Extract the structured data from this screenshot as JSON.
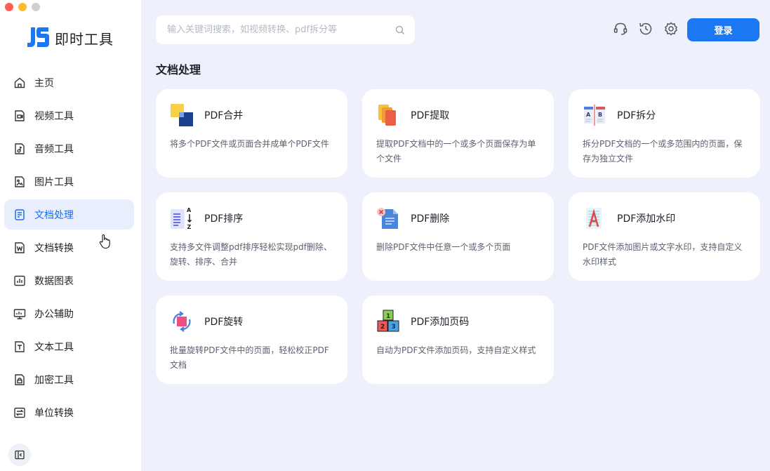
{
  "app": {
    "brand_name": "即时工具"
  },
  "sidebar": {
    "items": [
      {
        "label": "主页",
        "icon": "home-icon"
      },
      {
        "label": "视频工具",
        "icon": "video-file-icon"
      },
      {
        "label": "音频工具",
        "icon": "audio-file-icon"
      },
      {
        "label": "图片工具",
        "icon": "image-file-icon"
      },
      {
        "label": "文档处理",
        "icon": "document-icon",
        "active": true
      },
      {
        "label": "文档转换",
        "icon": "word-file-icon"
      },
      {
        "label": "数据图表",
        "icon": "chart-icon"
      },
      {
        "label": "办公辅助",
        "icon": "monitor-icon"
      },
      {
        "label": "文本工具",
        "icon": "text-file-icon"
      },
      {
        "label": "加密工具",
        "icon": "lock-file-icon"
      },
      {
        "label": "单位转换",
        "icon": "convert-icon"
      }
    ]
  },
  "search": {
    "placeholder": "输入关键词搜索，如视频转换、pdf拆分等"
  },
  "header": {
    "login_label": "登录"
  },
  "section": {
    "title": "文档处理"
  },
  "cards": [
    {
      "title": "PDF合并",
      "desc": "将多个PDF文件或页面合并成单个PDF文件"
    },
    {
      "title": "PDF提取",
      "desc": "提取PDF文档中的一个或多个页面保存为单个文件"
    },
    {
      "title": "PDF拆分",
      "desc": "拆分PDF文档的一个或多范围内的页面，保存为独立文件"
    },
    {
      "title": "PDF排序",
      "desc": "支持多文件调整pdf排序轻松实现pdf删除、旋转、排序、合并"
    },
    {
      "title": "PDF删除",
      "desc": "删除PDF文件中任意一个或多个页面"
    },
    {
      "title": "PDF添加水印",
      "desc": "PDF文件添加图片或文字水印，支持自定义水印样式"
    },
    {
      "title": "PDF旋转",
      "desc": "批量旋转PDF文件中的页面，轻松校正PDF文档"
    },
    {
      "title": "PDF添加页码",
      "desc": "自动为PDF文件添加页码，支持自定义样式"
    }
  ],
  "colors": {
    "accent": "#1b78f2",
    "active_bg": "#e9eefc",
    "background": "#eef1fb"
  }
}
